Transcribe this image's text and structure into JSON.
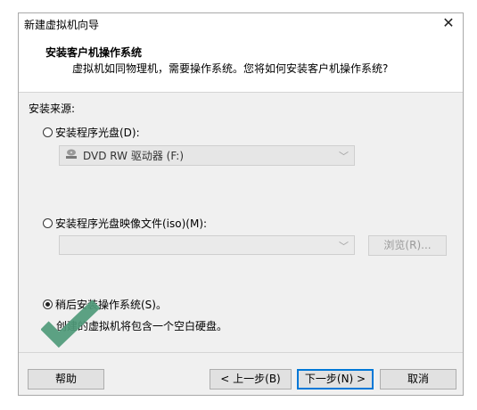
{
  "window": {
    "title": "新建虚拟机向导",
    "close_glyph": "✕"
  },
  "header": {
    "title": "安装客户机操作系统",
    "subtitle": "虚拟机如同物理机，需要操作系统。您将如何安装客户机操作系统?"
  },
  "source_label": "安装来源:",
  "options": {
    "disc": {
      "label": "安装程序光盘(D):",
      "selected": false,
      "drive_value": "DVD RW 驱动器 (F:)",
      "drive_icon": "disc-drive-icon"
    },
    "iso": {
      "label": "安装程序光盘映像文件(iso)(M):",
      "selected": false,
      "path_value": "",
      "browse_label": "浏览(R)..."
    },
    "later": {
      "label": "稍后安装操作系统(S)。",
      "selected": true,
      "description": "创建的虚拟机将包含一个空白硬盘。"
    }
  },
  "footer": {
    "help_label": "帮助",
    "back_label": "< 上一步(B)",
    "next_label": "下一步(N) >",
    "cancel_label": "取消"
  },
  "overlay": {
    "icon": "checkmark-icon",
    "color": "#4f9a7a"
  }
}
